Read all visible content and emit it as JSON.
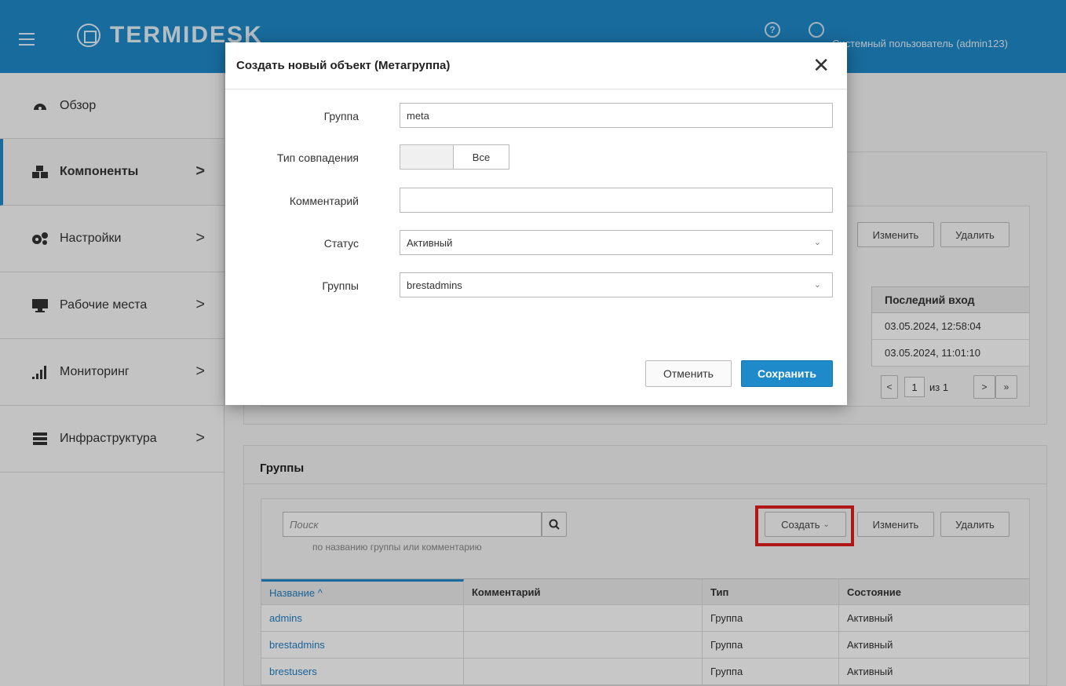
{
  "header": {
    "logo": "TERMIDESK",
    "help_icon": "?",
    "user": "Системный пользователь (admin123)"
  },
  "sidebar": {
    "items": [
      {
        "label": "Обзор",
        "icon": "dashboard-icon",
        "has_chevron": false
      },
      {
        "label": "Компоненты",
        "icon": "cubes-icon",
        "has_chevron": true,
        "active": true
      },
      {
        "label": "Настройки",
        "icon": "gears-icon",
        "has_chevron": true
      },
      {
        "label": "Рабочие места",
        "icon": "monitor-icon",
        "has_chevron": true
      },
      {
        "label": "Мониторинг",
        "icon": "signal-bars-icon",
        "has_chevron": true
      },
      {
        "label": "Инфраструктура",
        "icon": "server-icon",
        "has_chevron": true
      }
    ],
    "chevron": ">"
  },
  "users_panel": {
    "edit_button": "Изменить",
    "delete_button": "Удалить",
    "last_login_header": "Последний вход",
    "rows": [
      "03.05.2024, 12:58:04",
      "03.05.2024, 11:01:10"
    ],
    "pagination": {
      "prev": "<",
      "page": "1",
      "of": "из 1",
      "next": ">",
      "last": "»"
    }
  },
  "groups_panel": {
    "title": "Группы",
    "search_placeholder": "Поиск",
    "search_hint": "по названию группы или комментарию",
    "create_button": "Создать",
    "edit_button": "Изменить",
    "delete_button": "Удалить",
    "columns": [
      "Название ^",
      "Комментарий",
      "Тип",
      "Состояние"
    ],
    "rows": [
      {
        "name": "admins",
        "comment": "",
        "type": "Группа",
        "state": "Активный"
      },
      {
        "name": "brestadmins",
        "comment": "",
        "type": "Группа",
        "state": "Активный"
      },
      {
        "name": "brestusers",
        "comment": "",
        "type": "Группа",
        "state": "Активный"
      }
    ]
  },
  "modal": {
    "title": "Создать новый объект (Метагруппа)",
    "close": "✕",
    "fields": {
      "group_label": "Группа",
      "group_value": "meta",
      "match_label": "Тип совпадения",
      "match_value": "Все",
      "comment_label": "Комментарий",
      "comment_value": "",
      "status_label": "Статус",
      "status_value": "Активный",
      "groups_label": "Группы",
      "groups_value": "brestadmins"
    },
    "cancel_button": "Отменить",
    "save_button": "Сохранить"
  },
  "colors": {
    "header": "#1f8ac9",
    "primary_button": "#1f8ac9",
    "highlight": "#e41e1e"
  }
}
